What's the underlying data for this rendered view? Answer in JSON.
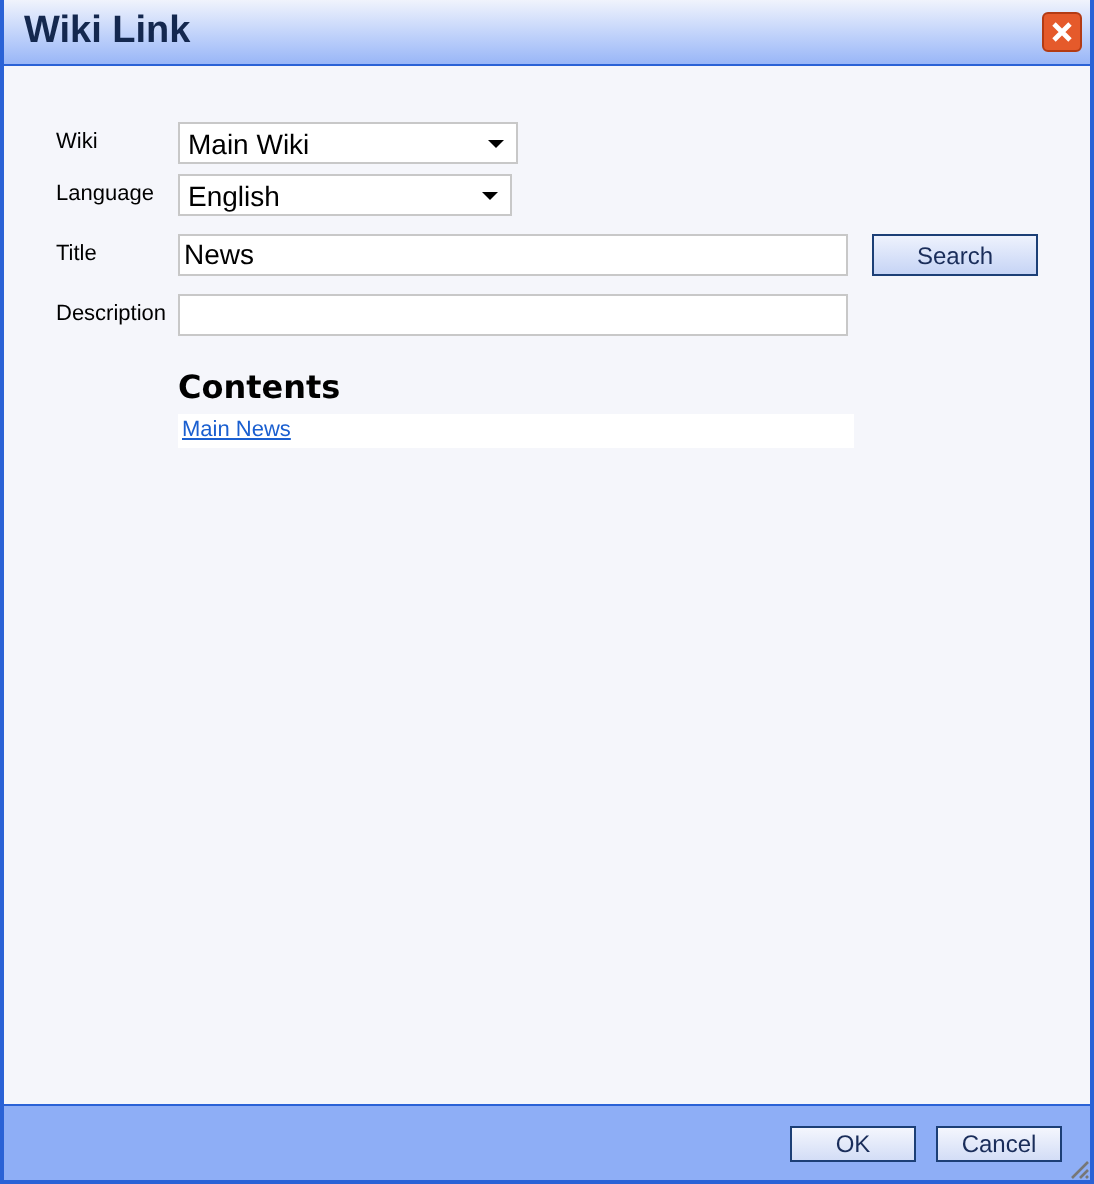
{
  "window": {
    "title": "Wiki Link"
  },
  "fields": [
    {
      "kind": "select",
      "label": "Wiki",
      "value": "Main Wiki"
    },
    {
      "kind": "select",
      "label": "Language",
      "value": "English"
    },
    {
      "kind": "text",
      "label": "Title",
      "value": "News",
      "button": "Search"
    },
    {
      "kind": "text",
      "label": "Description"
    }
  ],
  "contents": {
    "heading": "Contents",
    "links": [
      "Main News"
    ]
  },
  "buttons": [
    "OK",
    "Cancel"
  ]
}
